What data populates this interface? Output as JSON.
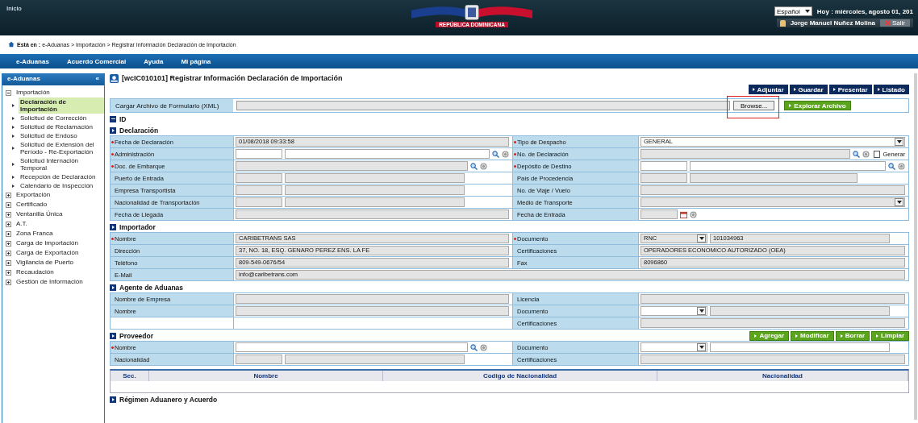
{
  "header": {
    "home_link": "Inicio",
    "logo_text": "REPÚBLICA DOMINICANA",
    "language": "Español",
    "date": "Hoy : miércoles, agosto 01, 201",
    "user": "Jorge Manuel Nuñez Molina",
    "logout": "Salir"
  },
  "breadcrumb": "**Está en :** e-Aduanas > Importación > Registrar Información Declaración de Importación",
  "nav": [
    "e-Aduanas",
    "Acuerdo Comercial",
    "Ayuda",
    "Mi página"
  ],
  "sidebar": {
    "title": "e-Aduanas",
    "collapse": "«",
    "items": [
      {
        "label": "Importación",
        "expanded": true,
        "children": [
          {
            "label": "Declaración de Importación",
            "selected": true
          },
          {
            "label": "Solicitud de Corrección",
            "selected": false
          },
          {
            "label": "Solicitud de Reclamación",
            "selected": false
          },
          {
            "label": "Solicitud de Endoso",
            "selected": false
          },
          {
            "label": "Solicitud de Extensión del Período - Re-Exportación",
            "selected": false
          },
          {
            "label": "Solicitud Internación Temporal",
            "selected": false
          },
          {
            "label": "Recepción de Declaración",
            "selected": false
          },
          {
            "label": "Calendario de Inspección",
            "selected": false
          }
        ]
      },
      {
        "label": "Exportación",
        "expanded": false
      },
      {
        "label": "Certificado",
        "expanded": false
      },
      {
        "label": "Ventanilla Única",
        "expanded": false
      },
      {
        "label": "A.T.",
        "expanded": false
      },
      {
        "label": "Zona Franca",
        "expanded": false
      },
      {
        "label": "Carga de Importación",
        "expanded": false
      },
      {
        "label": "Carga de Exportación",
        "expanded": false
      },
      {
        "label": "Vigilancia de Puerto",
        "expanded": false
      },
      {
        "label": "Recaudación",
        "expanded": false
      },
      {
        "label": "Gestión de Información",
        "expanded": false
      }
    ]
  },
  "page": {
    "title": "[wcIC010101] Registrar Información Declaración de Importación",
    "actions": [
      "Adjuntar",
      "Guardar",
      "Presentar",
      "Listado"
    ],
    "upload": {
      "label": "Cargar Archivo de Formulario (XML)",
      "browse": "Browse...",
      "highlighted": true,
      "explore": "Explorar Archivo"
    },
    "id_section": {
      "title": "ID",
      "expanded": true
    }
  },
  "sections": [
    {
      "title": "Declaración",
      "rows": [
        {
          "cells": [
            {
              "label": "Fecha de Declaración",
              "required": true,
              "fields": [
                {
                  "kind": "text",
                  "value": "01/08/2018 09:33:58",
                  "readonly": true
                }
              ]
            },
            {
              "label": "Tipo de Despacho",
              "required": true,
              "fields": [
                {
                  "kind": "select",
                  "value": "GENERAL",
                  "readonly": false
                }
              ]
            }
          ]
        },
        {
          "cells": [
            {
              "label": "Administración",
              "required": true,
              "lookup": true,
              "fields": [
                {
                  "kind": "text",
                  "readonly": false
                },
                {
                  "kind": "text",
                  "readonly": false
                }
              ]
            },
            {
              "label": "No. de Declaración",
              "required": true,
              "lookup": true,
              "checkbox": {
                "label": "Generar",
                "checked": false
              },
              "fields": [
                {
                  "kind": "text",
                  "readonly": true
                }
              ]
            }
          ]
        },
        {
          "cells": [
            {
              "label": "Doc. de Embarque",
              "required": true,
              "lookup": true,
              "fields": [
                {
                  "kind": "text",
                  "readonly": true
                }
              ]
            },
            {
              "label": "Depósito de Destino",
              "required": true,
              "lookup": true,
              "fields": [
                {
                  "kind": "text",
                  "readonly": false
                },
                {
                  "kind": "text",
                  "readonly": false
                }
              ]
            }
          ]
        },
        {
          "cells": [
            {
              "label": "Puerto de Entrada",
              "required": false,
              "fields": [
                {
                  "kind": "text",
                  "readonly": true
                },
                {
                  "kind": "text",
                  "readonly": true
                }
              ]
            },
            {
              "label": "País de Procedencia",
              "required": false,
              "fields": [
                {
                  "kind": "text",
                  "readonly": true
                },
                {
                  "kind": "text",
                  "readonly": true
                }
              ]
            }
          ]
        },
        {
          "cells": [
            {
              "label": "Empresa Transportista",
              "required": false,
              "fields": [
                {
                  "kind": "text",
                  "readonly": true
                },
                {
                  "kind": "text",
                  "readonly": true
                }
              ]
            },
            {
              "label": "No. de Viaje / Vuelo",
              "required": false,
              "fields": [
                {
                  "kind": "text",
                  "readonly": true
                }
              ]
            }
          ]
        },
        {
          "cells": [
            {
              "label": "Nacionalidad de Transportación",
              "required": false,
              "fields": [
                {
                  "kind": "text",
                  "readonly": true
                },
                {
                  "kind": "text",
                  "readonly": true
                }
              ]
            },
            {
              "label": "Medio de Transporte",
              "required": false,
              "fields": [
                {
                  "kind": "select",
                  "readonly": true
                }
              ]
            }
          ]
        },
        {
          "cells": [
            {
              "label": "Fecha de Llegada",
              "required": false,
              "fields": [
                {
                  "kind": "text",
                  "readonly": true
                }
              ]
            },
            {
              "label": "Fecha de Entrada",
              "required": false,
              "calendar": true,
              "fields": [
                {
                  "kind": "text",
                  "readonly": true
                }
              ]
            }
          ]
        }
      ]
    },
    {
      "title": "Importador",
      "rows": [
        {
          "cells": [
            {
              "label": "Nombre",
              "required": true,
              "fields": [
                {
                  "kind": "text",
                  "value": "CARIBETRANS SAS",
                  "readonly": true
                }
              ]
            },
            {
              "label": "Documento",
              "required": true,
              "fields": [
                {
                  "kind": "select",
                  "value": "RNC",
                  "readonly": true
                },
                {
                  "kind": "text",
                  "value": "101034963",
                  "readonly": true
                }
              ]
            }
          ]
        },
        {
          "cells": [
            {
              "label": "Dirección",
              "required": false,
              "fields": [
                {
                  "kind": "text",
                  "value": "37, NO. 18, ESQ. GENARO PEREZ ENS. LA FE",
                  "readonly": true
                }
              ]
            },
            {
              "label": "Certificaciones",
              "required": false,
              "fields": [
                {
                  "kind": "text",
                  "value": "OPERADORES ECONOMICO AUTORIZADO (OEA)",
                  "readonly": true
                }
              ]
            }
          ]
        },
        {
          "cells": [
            {
              "label": "Teléfono",
              "required": false,
              "fields": [
                {
                  "kind": "text",
                  "value": "809-549-0676/54",
                  "readonly": true
                }
              ]
            },
            {
              "label": "Fax",
              "required": false,
              "fields": [
                {
                  "kind": "text",
                  "value": "8096860",
                  "readonly": true
                }
              ]
            }
          ]
        },
        {
          "cells": [
            {
              "label": "E-Mail",
              "required": false,
              "fields": [
                {
                  "kind": "text",
                  "value": "info@caribetrans.com",
                  "readonly": true
                }
              ]
            }
          ]
        }
      ]
    },
    {
      "title": "Agente de Aduanas",
      "rows": [
        {
          "cells": [
            {
              "label": "Nombre de Empresa",
              "required": false,
              "fields": [
                {
                  "kind": "text",
                  "readonly": true
                }
              ]
            },
            {
              "label": "Licencia",
              "required": false,
              "fields": [
                {
                  "kind": "text",
                  "readonly": true
                }
              ]
            }
          ]
        },
        {
          "cells": [
            {
              "label": "Nombre",
              "required": false,
              "fields": [
                {
                  "kind": "text",
                  "readonly": true
                }
              ]
            },
            {
              "label": "Documento",
              "required": false,
              "fields": [
                {
                  "kind": "select",
                  "readonly": false
                },
                {
                  "kind": "text",
                  "readonly": true
                }
              ]
            }
          ]
        },
        {
          "cells": [
            {},
            {
              "label": "Certificaciones",
              "required": false,
              "fields": [
                {
                  "kind": "text",
                  "readonly": true
                }
              ]
            }
          ]
        }
      ]
    },
    {
      "title": "Proveedor",
      "actions": [
        "Agregar",
        "Modificar",
        "Borrar",
        "Limpiar"
      ],
      "rows": [
        {
          "cells": [
            {
              "label": "Nombre",
              "required": true,
              "lookup": true,
              "fields": [
                {
                  "kind": "text",
                  "readonly": false
                }
              ]
            },
            {
              "label": "Documento",
              "required": false,
              "fields": [
                {
                  "kind": "select",
                  "readonly": false
                },
                {
                  "kind": "text",
                  "readonly": false
                }
              ]
            }
          ]
        },
        {
          "cells": [
            {
              "label": "Nacionalidad",
              "required": false,
              "fields": [
                {
                  "kind": "text",
                  "readonly": true
                },
                {
                  "kind": "text",
                  "readonly": true
                }
              ]
            },
            {
              "label": "Certificaciones",
              "required": false,
              "fields": [
                {
                  "kind": "text",
                  "readonly": true
                }
              ]
            }
          ]
        }
      ],
      "table": {
        "columns": [
          "Sec.",
          "Nombre",
          "Codigo de Nacionalidad",
          "Nacionalidad"
        ]
      }
    },
    {
      "title": "Régimen Aduanero y Acuerdo"
    }
  ]
}
